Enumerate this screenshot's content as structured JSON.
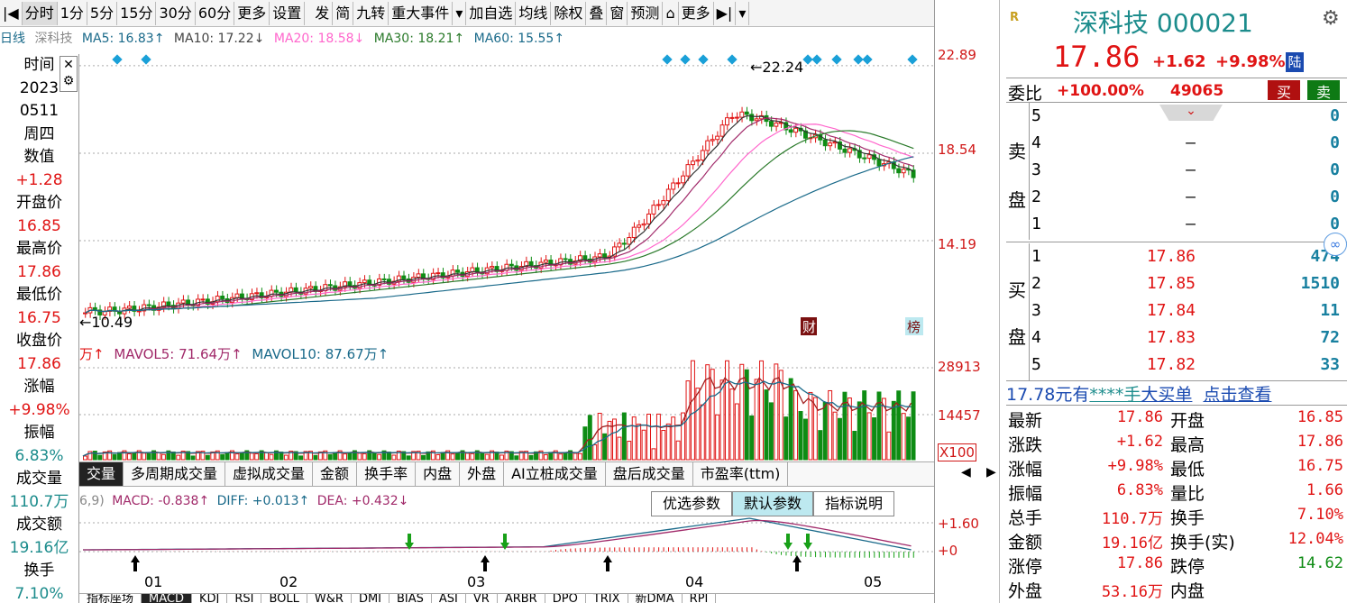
{
  "toolbar": {
    "items": [
      "分时",
      "1分",
      "5分",
      "15分",
      "30分",
      "60分",
      "更多",
      "设置",
      "发",
      "简",
      "九转",
      "重大事件",
      "加自选",
      "均线",
      "除权",
      "叠",
      "窗",
      "预测",
      "更多"
    ]
  },
  "ma_line": {
    "prefix": "日线",
    "name": "深科技",
    "ma5": "MA5: 16.83↑",
    "ma10": "MA10: 17.22↓",
    "ma20": "MA20: 18.58↓",
    "ma30": "MA30: 18.21↑",
    "ma60": "MA60: 15.55↑"
  },
  "left_info": [
    {
      "t": "时间",
      "c": ""
    },
    {
      "t": "2023",
      "c": ""
    },
    {
      "t": "0511",
      "c": ""
    },
    {
      "t": "周四",
      "c": ""
    },
    {
      "t": "数值",
      "c": ""
    },
    {
      "t": "+1.28",
      "c": "red"
    },
    {
      "t": "开盘价",
      "c": ""
    },
    {
      "t": "16.85",
      "c": "red"
    },
    {
      "t": "最高价",
      "c": ""
    },
    {
      "t": "17.86",
      "c": "red"
    },
    {
      "t": "最低价",
      "c": ""
    },
    {
      "t": "16.75",
      "c": "red"
    },
    {
      "t": "收盘价",
      "c": ""
    },
    {
      "t": "17.86",
      "c": "red"
    },
    {
      "t": "涨幅",
      "c": ""
    },
    {
      "t": "+9.98%",
      "c": "red"
    },
    {
      "t": "振幅",
      "c": ""
    },
    {
      "t": "6.83%",
      "c": "teal"
    },
    {
      "t": "成交量",
      "c": ""
    },
    {
      "t": "110.7万",
      "c": "teal"
    },
    {
      "t": "成交额",
      "c": ""
    },
    {
      "t": "19.16亿",
      "c": "teal"
    },
    {
      "t": "换手",
      "c": ""
    },
    {
      "t": "7.10%",
      "c": "teal"
    }
  ],
  "price_axis": {
    "top": "22.89",
    "mid": "18.54",
    "low": "14.19",
    "max_label": "22.24",
    "min_label": "10.49",
    "tag_fin": "财",
    "tag_list": "榜"
  },
  "vol_line": {
    "vol": "万↑",
    "mavol5": "MAVOL5: 71.64万↑",
    "mavol10": "MAVOL10: 87.67万↑",
    "axis_top": "28913",
    "axis_mid": "14457",
    "axis_unit": "X100"
  },
  "vol_tabs": [
    "交量",
    "多周期成交量",
    "虚拟成交量",
    "金额",
    "换手率",
    "内盘",
    "外盘",
    "AI立桩成交量",
    "盘后成交量",
    "市盈率(ttm)"
  ],
  "macd_line": {
    "param": "6,9)",
    "macd": "MACD: -0.838↑",
    "diff": "DIFF: +0.013↑",
    "dea": "DEA: +0.432↓",
    "axis_top": "+1.60",
    "axis_zero": "+0"
  },
  "macd_buttons": [
    "优选参数",
    "默认参数",
    "指标说明"
  ],
  "x_axis": [
    "01",
    "02",
    "03",
    "04",
    "05"
  ],
  "bottom_tabs": [
    "指标座场",
    "MACD",
    "KDJ",
    "RSI",
    "BOLL",
    "W&R",
    "DMI",
    "BIAS",
    "ASI",
    "VR",
    "ARBR",
    "DPO",
    "TRIX",
    "新DMA",
    "RPI"
  ],
  "quote": {
    "name": "深科技",
    "code": "000021",
    "price": "17.86",
    "change": "+1.62",
    "pct": "+9.98%",
    "market_tag": "陆",
    "r_tag": "R",
    "weibi_label": "委比",
    "weibi": "+100.00%",
    "weicha": "49065",
    "buy_btn": "买",
    "sell_btn": "卖"
  },
  "asks": [
    {
      "lv": "5",
      "price": "",
      "vol": "0"
    },
    {
      "lv": "4",
      "price": "–",
      "vol": "0"
    },
    {
      "lv": "3",
      "price": "–",
      "vol": "0"
    },
    {
      "lv": "2",
      "price": "–",
      "vol": "0"
    },
    {
      "lv": "1",
      "price": "–",
      "vol": "0"
    }
  ],
  "bids": [
    {
      "lv": "1",
      "price": "17.86",
      "vol": "474"
    },
    {
      "lv": "2",
      "price": "17.85",
      "vol": "1510"
    },
    {
      "lv": "3",
      "price": "17.84",
      "vol": "11"
    },
    {
      "lv": "4",
      "price": "17.83",
      "vol": "72"
    },
    {
      "lv": "5",
      "price": "17.82",
      "vol": "33"
    }
  ],
  "side_labels": {
    "sell_top": "卖",
    "sell_bottom": "盘",
    "buy_top": "买",
    "buy_bottom": "盘"
  },
  "bigbuy": {
    "price": "17.78元有",
    "stars": "****手",
    "text": "大买单",
    "link": "点击查看"
  },
  "stats": [
    {
      "k1": "最新",
      "v1": "17.86",
      "c1": "red",
      "k2": "开盘",
      "v2": "16.85",
      "c2": "red"
    },
    {
      "k1": "涨跌",
      "v1": "+1.62",
      "c1": "red",
      "k2": "最高",
      "v2": "17.86",
      "c2": "red"
    },
    {
      "k1": "涨幅",
      "v1": "+9.98%",
      "c1": "red",
      "k2": "最低",
      "v2": "16.75",
      "c2": "red"
    },
    {
      "k1": "振幅",
      "v1": "6.83%",
      "c1": "red",
      "k2": "量比",
      "v2": "1.66",
      "c2": "red"
    },
    {
      "k1": "总手",
      "v1": "110.7万",
      "c1": "red",
      "k2": "换手",
      "v2": "7.10%",
      "c2": "red"
    },
    {
      "k1": "金额",
      "v1": "19.16亿",
      "c1": "red",
      "k2": "换手(实)",
      "v2": "12.04%",
      "c2": "red"
    },
    {
      "k1": "涨停",
      "v1": "17.86",
      "c1": "red",
      "k2": "跌停",
      "v2": "14.62",
      "c2": "green"
    },
    {
      "k1": "外盘",
      "v1": "53.16万",
      "c1": "red",
      "k2": "内盘",
      "v2": "",
      "c2": "green"
    }
  ],
  "colors": {
    "up": "#e01414",
    "down": "#0e8c14",
    "ma5": "#333333",
    "ma10": "#a12a6a",
    "ma20": "#ff66cc",
    "ma30": "#2a7a2a",
    "ma60": "#1a6a8a"
  }
}
